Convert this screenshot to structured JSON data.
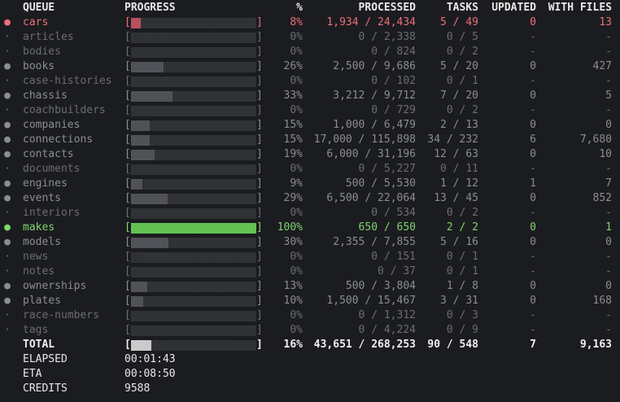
{
  "columns": {
    "queue": "QUEUE",
    "progress": "PROGRESS",
    "percent": "%",
    "processed": "PROCESSED",
    "tasks": "TASKS",
    "updated": "UPDATED",
    "with_files": "WITH FILES"
  },
  "bar_brackets": {
    "open": "[",
    "close": "]"
  },
  "colors": {
    "background": "#1b1c1f",
    "active": "#ea6f7b",
    "active_fill": "#b54b57",
    "complete": "#7fd56f",
    "complete_fill": "#5ec04e",
    "bar_fill": "#4b4d53",
    "bar_track": "#2b2c30",
    "total_fill": "#c9c9c9"
  },
  "rows": [
    {
      "queue": "cars",
      "dot": "●",
      "status": "active",
      "progress": 0.08,
      "percent": "8%",
      "processed": "1,934 / 24,434",
      "tasks": "5 / 49",
      "updated": "0",
      "with_files": "13"
    },
    {
      "queue": "articles",
      "dot": "·",
      "status": "empty",
      "progress": 0,
      "percent": "0%",
      "processed": "0 / 2,338",
      "tasks": "0 / 5",
      "updated": "-",
      "with_files": "-"
    },
    {
      "queue": "bodies",
      "dot": "·",
      "status": "empty",
      "progress": 0,
      "percent": "0%",
      "processed": "0 / 824",
      "tasks": "0 / 2",
      "updated": "-",
      "with_files": "-"
    },
    {
      "queue": "books",
      "dot": "●",
      "status": "partial",
      "progress": 0.26,
      "percent": "26%",
      "processed": "2,500 / 9,686",
      "tasks": "5 / 20",
      "updated": "0",
      "with_files": "427"
    },
    {
      "queue": "case-histories",
      "dot": "·",
      "status": "empty",
      "progress": 0,
      "percent": "0%",
      "processed": "0 / 102",
      "tasks": "0 / 1",
      "updated": "-",
      "with_files": "-"
    },
    {
      "queue": "chassis",
      "dot": "●",
      "status": "partial",
      "progress": 0.33,
      "percent": "33%",
      "processed": "3,212 / 9,712",
      "tasks": "7 / 20",
      "updated": "0",
      "with_files": "5"
    },
    {
      "queue": "coachbuilders",
      "dot": "·",
      "status": "empty",
      "progress": 0,
      "percent": "0%",
      "processed": "0 / 729",
      "tasks": "0 / 2",
      "updated": "-",
      "with_files": "-"
    },
    {
      "queue": "companies",
      "dot": "●",
      "status": "partial",
      "progress": 0.15,
      "percent": "15%",
      "processed": "1,000 / 6,479",
      "tasks": "2 / 13",
      "updated": "0",
      "with_files": "0"
    },
    {
      "queue": "connections",
      "dot": "●",
      "status": "partial",
      "progress": 0.15,
      "percent": "15%",
      "processed": "17,000 / 115,898",
      "tasks": "34 / 232",
      "updated": "6",
      "with_files": "7,680"
    },
    {
      "queue": "contacts",
      "dot": "●",
      "status": "partial",
      "progress": 0.19,
      "percent": "19%",
      "processed": "6,000 / 31,196",
      "tasks": "12 / 63",
      "updated": "0",
      "with_files": "10"
    },
    {
      "queue": "documents",
      "dot": "·",
      "status": "empty",
      "progress": 0,
      "percent": "0%",
      "processed": "0 / 5,227",
      "tasks": "0 / 11",
      "updated": "-",
      "with_files": "-"
    },
    {
      "queue": "engines",
      "dot": "●",
      "status": "partial",
      "progress": 0.09,
      "percent": "9%",
      "processed": "500 / 5,530",
      "tasks": "1 / 12",
      "updated": "1",
      "with_files": "7"
    },
    {
      "queue": "events",
      "dot": "●",
      "status": "partial",
      "progress": 0.29,
      "percent": "29%",
      "processed": "6,500 / 22,064",
      "tasks": "13 / 45",
      "updated": "0",
      "with_files": "852"
    },
    {
      "queue": "interiors",
      "dot": "·",
      "status": "empty",
      "progress": 0,
      "percent": "0%",
      "processed": "0 / 534",
      "tasks": "0 / 2",
      "updated": "-",
      "with_files": "-"
    },
    {
      "queue": "makes",
      "dot": "●",
      "status": "complete",
      "progress": 1.0,
      "percent": "100%",
      "processed": "650 / 650",
      "tasks": "2 / 2",
      "updated": "0",
      "with_files": "1"
    },
    {
      "queue": "models",
      "dot": "●",
      "status": "partial",
      "progress": 0.3,
      "percent": "30%",
      "processed": "2,355 / 7,855",
      "tasks": "5 / 16",
      "updated": "0",
      "with_files": "0"
    },
    {
      "queue": "news",
      "dot": "·",
      "status": "empty",
      "progress": 0,
      "percent": "0%",
      "processed": "0 / 151",
      "tasks": "0 / 1",
      "updated": "-",
      "with_files": "-"
    },
    {
      "queue": "notes",
      "dot": "·",
      "status": "empty",
      "progress": 0,
      "percent": "0%",
      "processed": "0 / 37",
      "tasks": "0 / 1",
      "updated": "-",
      "with_files": "-"
    },
    {
      "queue": "ownerships",
      "dot": "●",
      "status": "partial",
      "progress": 0.13,
      "percent": "13%",
      "processed": "500 / 3,804",
      "tasks": "1 / 8",
      "updated": "0",
      "with_files": "0"
    },
    {
      "queue": "plates",
      "dot": "●",
      "status": "partial",
      "progress": 0.1,
      "percent": "10%",
      "processed": "1,500 / 15,467",
      "tasks": "3 / 31",
      "updated": "0",
      "with_files": "168"
    },
    {
      "queue": "race-numbers",
      "dot": "·",
      "status": "empty",
      "progress": 0,
      "percent": "0%",
      "processed": "0 / 1,312",
      "tasks": "0 / 3",
      "updated": "-",
      "with_files": "-"
    },
    {
      "queue": "tags",
      "dot": "·",
      "status": "empty",
      "progress": 0,
      "percent": "0%",
      "processed": "0 / 4,224",
      "tasks": "0 / 9",
      "updated": "-",
      "with_files": "-"
    }
  ],
  "total": {
    "label": "TOTAL",
    "progress": 0.16,
    "percent": "16%",
    "processed": "43,651 / 268,253",
    "tasks": "90 / 548",
    "updated": "7",
    "with_files": "9,163"
  },
  "stats": [
    {
      "label": "ELAPSED",
      "value": "00:01:43"
    },
    {
      "label": "ETA",
      "value": "00:08:50"
    },
    {
      "label": "CREDITS",
      "value": "9588"
    }
  ]
}
